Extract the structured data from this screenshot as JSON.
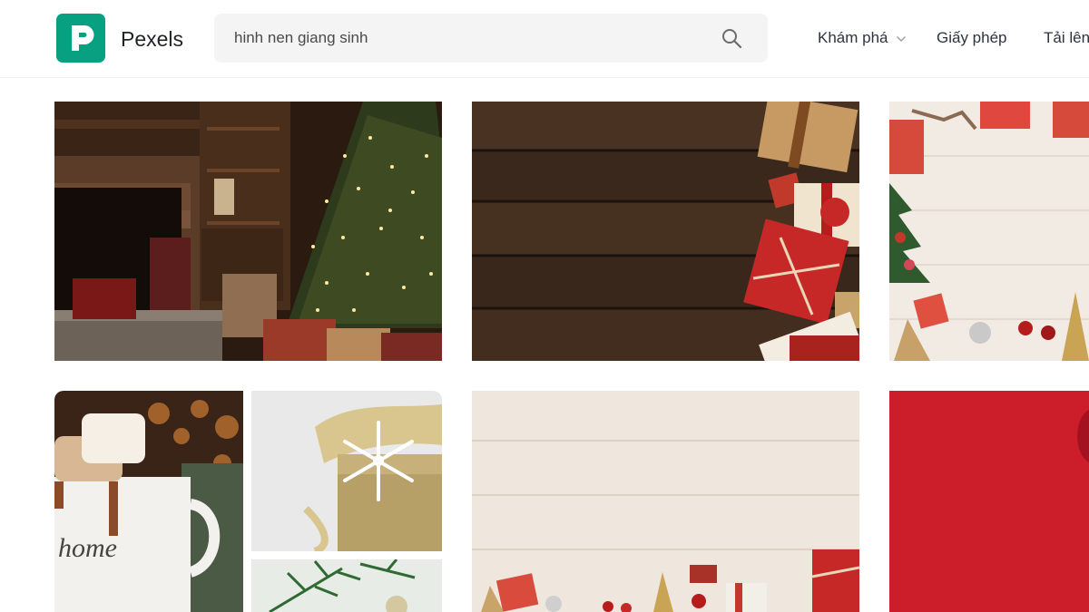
{
  "header": {
    "brand": "Pexels",
    "logo_icon": "pexels-logo-icon",
    "brand_color": "#07a081",
    "search": {
      "value": "hinh nen giang sinh",
      "icon": "search-icon"
    },
    "nav": [
      {
        "label": "Khám phá",
        "has_dropdown": true
      },
      {
        "label": "Giấy phép"
      },
      {
        "label": "Tải lên"
      }
    ]
  },
  "photos": [
    {
      "subject": "christmas-tree-living-room"
    },
    {
      "subject": "gifts-on-dark-wood"
    },
    {
      "subject": "christmas-frame-white-wood"
    },
    {
      "subject": "cocoa-mug-marshmallows",
      "mug_text": "home"
    },
    {
      "subject": "snowflake-gift-box"
    },
    {
      "subject": "pine-branch-ornament"
    },
    {
      "subject": "christmas-border-light-wood"
    },
    {
      "subject": "red-background"
    }
  ]
}
